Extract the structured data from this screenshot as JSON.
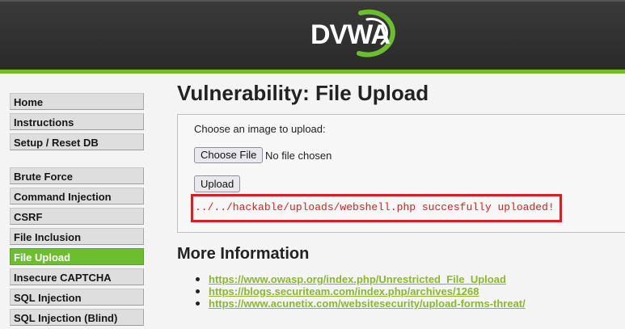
{
  "header": {
    "logo_text": "DVWA",
    "accent_color": "#6cbe2f"
  },
  "menu": {
    "groups": [
      [
        "Home",
        "Instructions",
        "Setup / Reset DB"
      ],
      [
        "Brute Force",
        "Command Injection",
        "CSRF",
        "File Inclusion",
        "File Upload",
        "Insecure CAPTCHA",
        "SQL Injection",
        "SQL Injection (Blind)"
      ]
    ],
    "active": "File Upload"
  },
  "main": {
    "title": "Vulnerability: File Upload",
    "upload_prompt": "Choose an image to upload:",
    "choose_file_label": "Choose File",
    "no_file_text": "No file chosen",
    "upload_label": "Upload",
    "result_message": "../../hackable/uploads/webshell.php succesfully uploaded!",
    "result_color": "#e11b1b",
    "more_info_title": "More Information",
    "links": [
      "https://www.owasp.org/index.php/Unrestricted_File_Upload",
      "https://blogs.securiteam.com/index.php/archives/1268",
      "https://www.acunetix.com/websitesecurity/upload-forms-threat/"
    ],
    "link_color": "#8ab82d"
  }
}
